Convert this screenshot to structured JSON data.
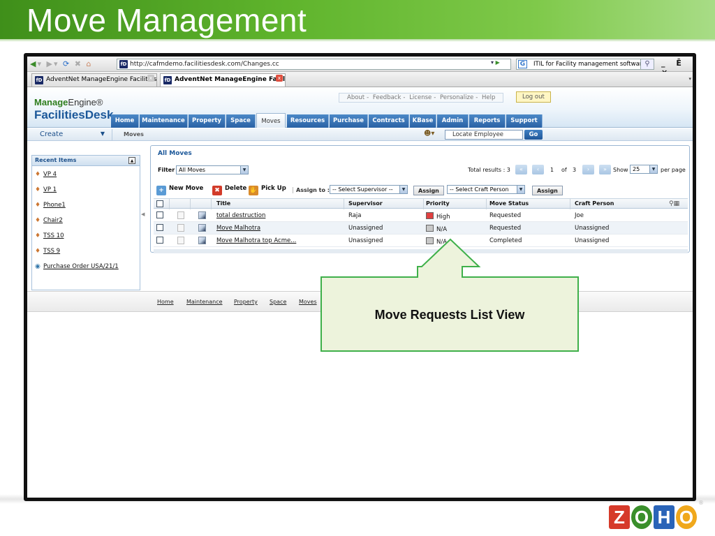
{
  "slide": {
    "title": "Move Management",
    "callout_label": "Move Requests List View",
    "logo_letters": [
      "Z",
      "O",
      "H",
      "O"
    ],
    "logo_colors": [
      "#d63a2a",
      "#3a8f2b",
      "#2a64b8",
      "#f0a81c"
    ]
  },
  "browser": {
    "url": "http://cafmdemo.facilitiesdesk.com/Changes.cc",
    "search_text": "ITIL for Facility management software?",
    "window_controls": "_ Ē ×",
    "tabs": [
      {
        "label": "AdventNet ManageEngine FacilitiesDesk",
        "active": false
      },
      {
        "label": "AdventNet ManageEngine Faciliti...",
        "active": true
      }
    ]
  },
  "app": {
    "logo_top_a": "Manage",
    "logo_top_b": "Engine®",
    "logo_bottom": "FacilitiesDesk",
    "util_links": [
      "About",
      "Feedback",
      "License",
      "Personalize",
      "Help"
    ],
    "logout_label": "Log out",
    "main_tabs": [
      "Home",
      "Maintenance",
      "Property",
      "Space",
      "Moves",
      "Resources",
      "Purchase",
      "Contracts",
      "KBase",
      "Admin",
      "Reports",
      "Support"
    ],
    "active_tab": "Moves",
    "create_label": "Create",
    "breadcrumb": "Moves",
    "locate_placeholder": "Locate Employee",
    "go_label": "Go"
  },
  "recent": {
    "title": "Recent Items",
    "items": [
      "VP 4",
      "VP 1",
      "Phone1",
      "Chair2",
      "TSS 10",
      "TSS 9",
      "Purchase Order USA/21/1"
    ]
  },
  "moves": {
    "title": "All Moves",
    "filter_label": "Filter",
    "filter_value": "All Moves",
    "total_label": "Total results : 3",
    "page_current": "1",
    "page_of": "of",
    "page_total": "3",
    "show_label": "Show",
    "per_page_value": "25",
    "per_page_label": "per page",
    "actions": {
      "new_move": "New Move",
      "delete": "Delete",
      "pick_up": "Pick Up",
      "assign_to": "Assign to :",
      "supervisor_select": "-- Select Supervisor --",
      "assign1": "Assign",
      "craft_select": "-- Select Craft Person",
      "assign2": "Assign"
    },
    "columns": [
      "Title",
      "Supervisor",
      "Priority",
      "Move Status",
      "Craft Person"
    ],
    "rows": [
      {
        "title": "total destruction",
        "supervisor": "Raja",
        "priority": "High",
        "priority_color": "#e04040",
        "status": "Requested",
        "craft": "Joe"
      },
      {
        "title": "Move Malhotra",
        "supervisor": "Unassigned",
        "priority": "N/A",
        "priority_color": "#c8c8c8",
        "status": "Requested",
        "craft": "Unassigned"
      },
      {
        "title": "Move Malhotra top Acme...",
        "supervisor": "Unassigned",
        "priority": "N/A",
        "priority_color": "#c8c8c8",
        "status": "Completed",
        "craft": "Unassigned"
      }
    ]
  },
  "footer_links": [
    "Home",
    "Maintenance",
    "Property",
    "Space",
    "Moves"
  ]
}
